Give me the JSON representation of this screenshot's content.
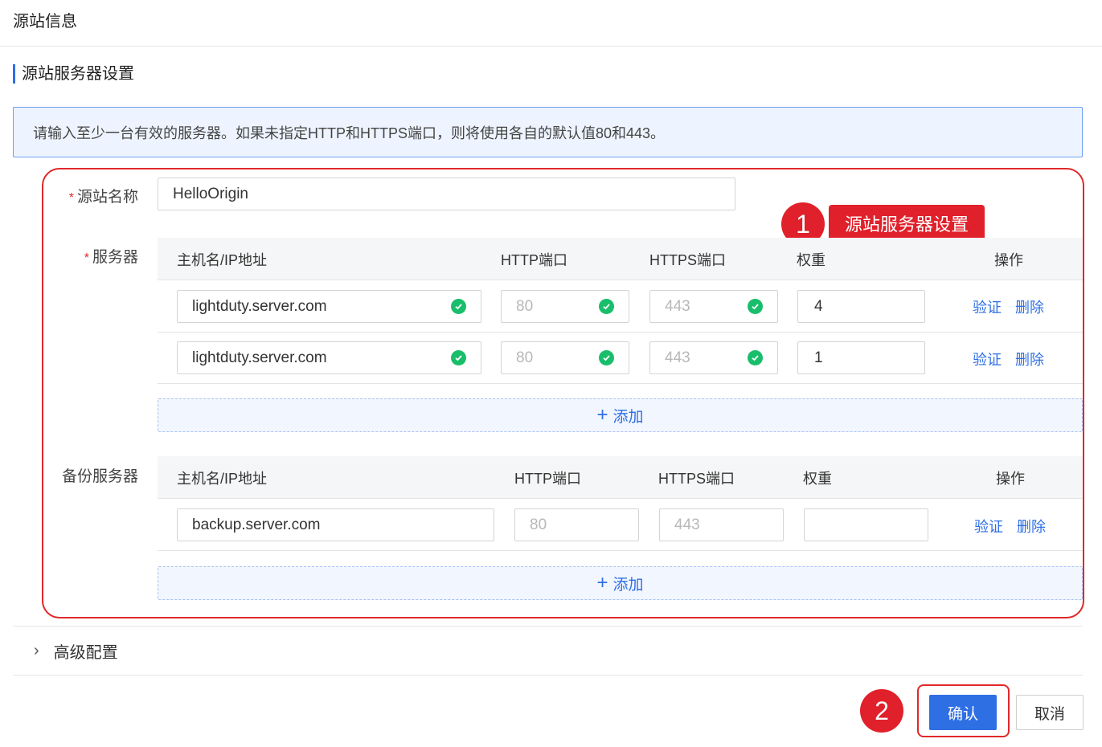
{
  "page": {
    "title": "源站信息"
  },
  "section": {
    "title": "源站服务器设置"
  },
  "notice": {
    "text": "请输入至少一台有效的服务器。如果未指定HTTP和HTTPS端口，则将使用各自的默认值80和443。"
  },
  "form": {
    "required_mark": "*",
    "origin_name": {
      "label": "源站名称",
      "value": "HelloOrigin"
    },
    "servers": {
      "label": "服务器",
      "columns": {
        "host": "主机名/IP地址",
        "http": "HTTP端口",
        "https": "HTTPS端口",
        "weight": "权重",
        "ops": "操作"
      },
      "rows": [
        {
          "host": "lightduty.server.com",
          "http": "80",
          "https": "443",
          "weight": "4"
        },
        {
          "host": "lightduty.server.com",
          "http": "80",
          "https": "443",
          "weight": "1"
        }
      ],
      "add_label": "添加"
    },
    "backup": {
      "label": "备份服务器",
      "columns": {
        "host": "主机名/IP地址",
        "http": "HTTP端口",
        "https": "HTTPS端口",
        "weight": "权重",
        "ops": "操作"
      },
      "rows": [
        {
          "host": "backup.server.com",
          "http": "80",
          "https": "443",
          "weight": ""
        }
      ],
      "add_label": "添加"
    },
    "verify_label": "验证",
    "delete_label": "删除"
  },
  "annotations": {
    "step1_number": "1",
    "step1_label": "源站服务器设置",
    "step2_number": "2"
  },
  "advanced": {
    "label": "高级配置"
  },
  "footer": {
    "confirm_label": "确认",
    "cancel_label": "取消"
  },
  "colors": {
    "accent": "#2f6fe4",
    "annotation": "#e0202a",
    "success": "#19be6b"
  }
}
